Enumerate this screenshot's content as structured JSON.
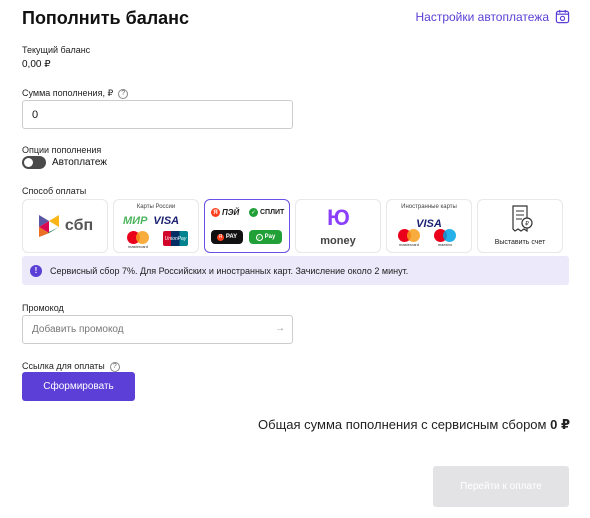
{
  "header": {
    "title": "Пополнить баланс",
    "autopay_settings": "Настройки автоплатежа"
  },
  "balance": {
    "label": "Текущий баланс",
    "value": "0,00 ₽"
  },
  "amount": {
    "label": "Сумма пополнения, ₽",
    "value": "0"
  },
  "options": {
    "label": "Опции пополнения",
    "autopay_label": "Автоплатеж",
    "autopay_enabled": false
  },
  "payment": {
    "label": "Способ оплаты",
    "methods": [
      {
        "id": "sbp",
        "text": "сбп",
        "selected": false
      },
      {
        "id": "russia-cards",
        "caption": "Карты России",
        "brands": [
          "МИР",
          "VISA",
          "mastercard",
          "UnionPay"
        ],
        "selected": false
      },
      {
        "id": "yandex",
        "brands": [
          "ПЭЙ",
          "СПЛИТ",
          "PAY",
          "Pay"
        ],
        "selected": true
      },
      {
        "id": "yoomoney",
        "logo": "Ю",
        "text": "money",
        "selected": false
      },
      {
        "id": "foreign-cards",
        "caption": "Иностранные карты",
        "brands": [
          "VISA",
          "mastercard",
          "maestro"
        ],
        "selected": false
      },
      {
        "id": "invoice",
        "caption": "Выставить счет",
        "selected": false
      }
    ]
  },
  "notice": {
    "text": "Сервисный сбор 7%. Для Российских и иностранных карт. Зачисление около 2 минут."
  },
  "promo": {
    "label": "Промокод",
    "placeholder": "Добавить промокод",
    "arrow": "→"
  },
  "link": {
    "label": "Ссылка для оплаты",
    "button": "Сформировать"
  },
  "total": {
    "label": "Общая сумма пополнения с сервисным сбором",
    "value": "0 ₽"
  },
  "pay_button": "Перейти к оплате",
  "colors": {
    "accent": "#5b3fd6",
    "notice_bg": "#ebe9fa",
    "disabled_button": "#e3e3e6"
  }
}
